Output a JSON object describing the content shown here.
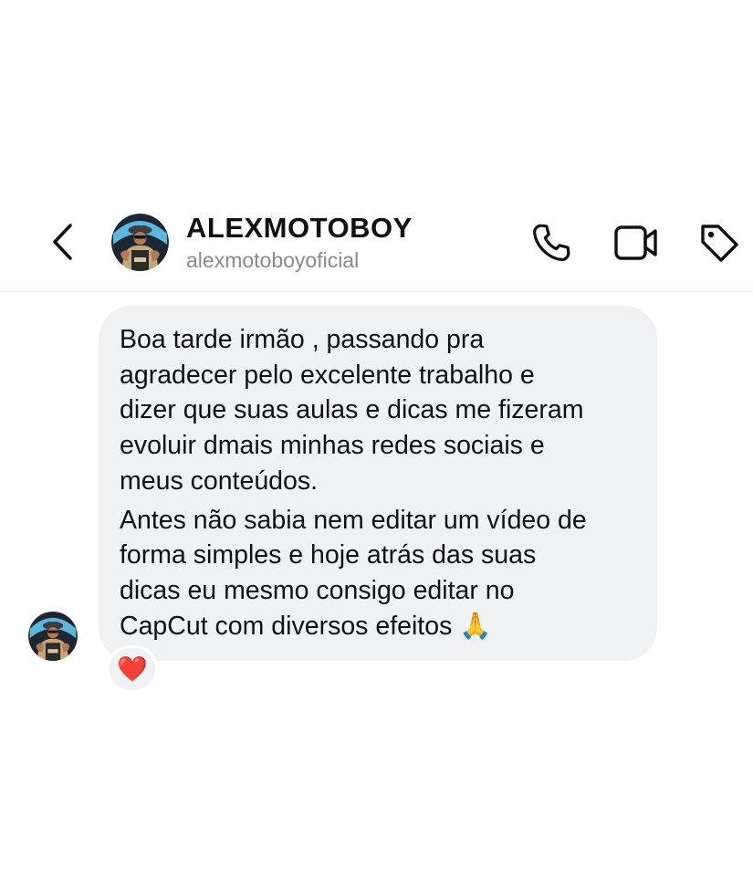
{
  "header": {
    "name": "ALEXMOTOBOY",
    "handle": "alexmotoboyoficial",
    "back_icon": "chevron-left-icon",
    "actions": [
      "phone-icon",
      "video-camera-icon",
      "tag-icon"
    ]
  },
  "message": {
    "paragraphs": [
      "Boa tarde irmão , passando pra\nagradecer pelo excelente trabalho e\ndizer que suas aulas e dicas me fizeram\nevoluir dmais minhas redes sociais e\nmeus conteúdos.",
      "Antes não sabia nem editar um vídeo de\nforma simples e hoje atrás das suas\ndicas eu mesmo consigo editar no\nCapCut com diversos efeitos 🙏"
    ],
    "reaction": "❤️"
  },
  "colors": {
    "bubble": "#f0f1f3",
    "handle": "#8a8a8a",
    "reaction": "#e8112d"
  }
}
